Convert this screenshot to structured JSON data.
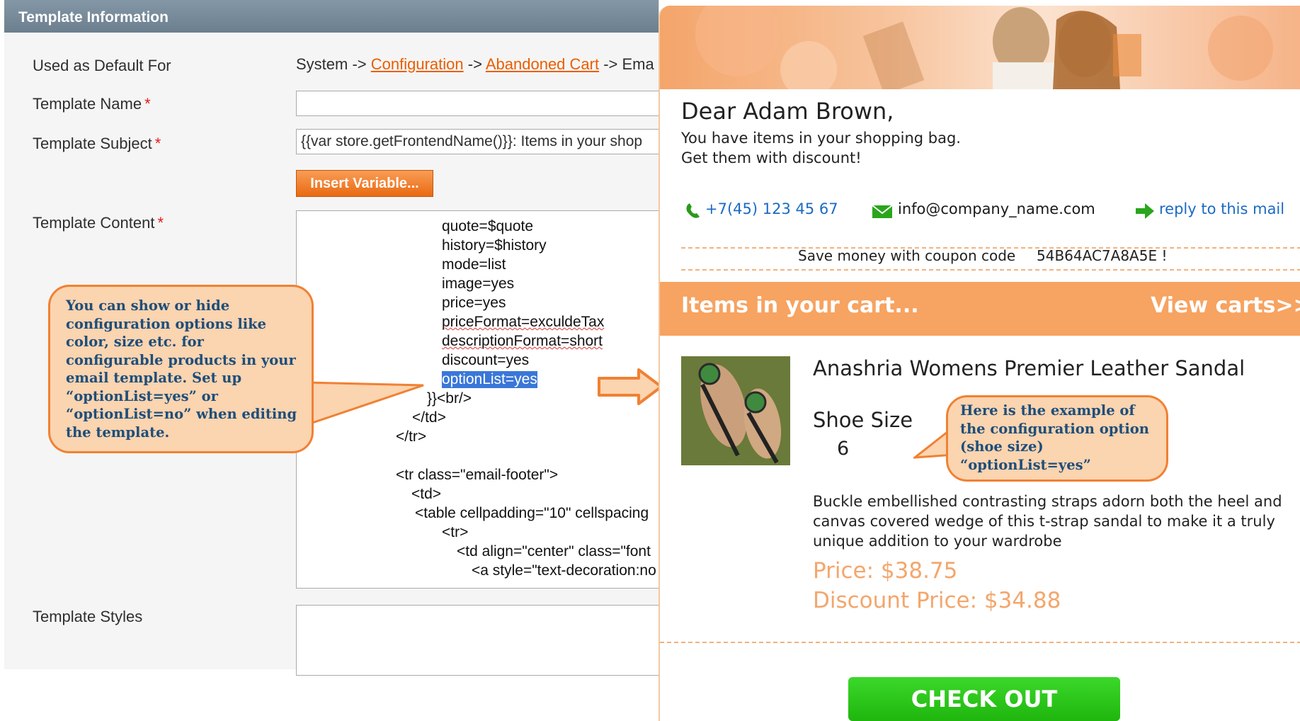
{
  "admin": {
    "header_title": "Template Information",
    "used_default_label": "Used as Default For",
    "used_default_path": {
      "prefix": "System ->",
      "link1": "Configuration",
      "sep1": "->",
      "link2": "Abandoned Cart",
      "suffix": "-> Ema"
    },
    "template_name_label": "Template Name",
    "template_name_value": "",
    "template_subject_label": "Template Subject",
    "template_subject_value": "{{var store.getFrontendName()}}: Items in your shop",
    "insert_variable_label": "Insert Variable...",
    "template_content_label": "Template Content",
    "template_styles_label": "Template Styles",
    "required_mark": "*",
    "code_lines": [
      "quote=$quote",
      "history=$history",
      "mode=list",
      "image=yes",
      "price=yes",
      "priceFormat=exculdeTax",
      "descriptionFormat=short",
      "discount=yes",
      "optionList=yes",
      "}}<br/>",
      "</td>",
      "</tr>",
      "<tr class=\"email-footer\">",
      "<td>",
      "<table cellpadding=\"10\" cellspacing",
      "<tr>",
      "<td align=\"center\" class=\"font",
      "<a style=\"text-decoration:no"
    ]
  },
  "callouts": {
    "left": "You can show or hide configuration options like color, size etc.  for configurable products in your email template. Set up “optionList=yes” or “optionList=no” when editing the  template.",
    "right": "Here is  the example of the configuration option (shoe size) “optionList=yes”"
  },
  "email": {
    "greeting": "Dear Adam Brown,",
    "line1": "You have items in your shopping bag.",
    "line2": "Get them with discount!",
    "phone": "+7(45) 123 45 67",
    "email_address": "info@company_name.com",
    "reply": "reply to this mail",
    "coupon_text": "Save money with coupon code",
    "coupon_code": "54B64AC7A8A5E !",
    "cart_title": "Items in your cart...",
    "view_carts": "View carts>>",
    "product_name": "Anashria Womens Premier Leather Sandal",
    "option_label": "Shoe Size",
    "option_value": "6",
    "description": [
      "Buckle embellished contrasting straps adorn both the heel and",
      "canvas covered wedge of this t-strap sandal to make it a truly",
      "unique addition to your wardrobe"
    ],
    "price": "Price: $38.75",
    "discount_price": "Discount Price: $34.88",
    "checkout_label": "CHECK OUT",
    "colors": {
      "accent": "#f7a361",
      "checkout": "#2ac71a",
      "link": "#1a6bc4",
      "price": "#f4a66c"
    }
  }
}
